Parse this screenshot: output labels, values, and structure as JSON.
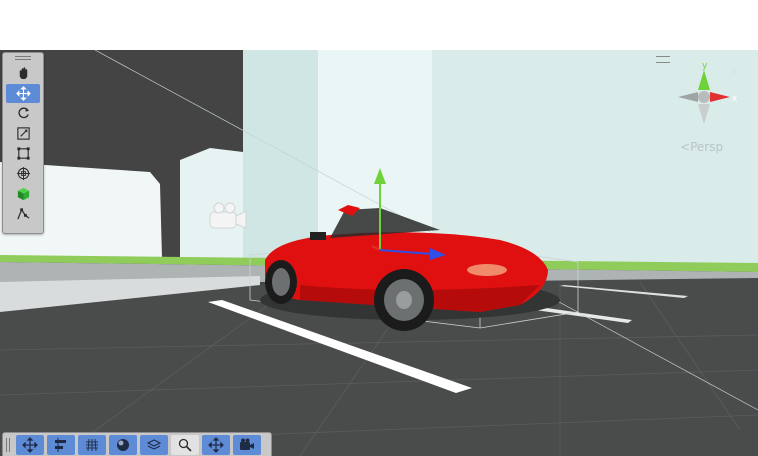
{
  "scene_view": {
    "projection_label": "Persp",
    "axis_labels": {
      "y": "y",
      "x": "x"
    }
  },
  "tools_overlay": {
    "items": [
      {
        "name": "view-tool",
        "icon": "hand-icon",
        "active": false
      },
      {
        "name": "move-tool",
        "icon": "move-arrows-icon",
        "active": true
      },
      {
        "name": "rotate-tool",
        "icon": "rotate-icon",
        "active": false
      },
      {
        "name": "scale-tool",
        "icon": "scale-icon",
        "active": false
      },
      {
        "name": "rect-tool",
        "icon": "rect-transform-icon",
        "active": false
      },
      {
        "name": "transform-tool",
        "icon": "transform-icon",
        "active": false
      },
      {
        "name": "custom-cube-tool",
        "icon": "green-cube-icon",
        "active": false
      },
      {
        "name": "custom-path-tool",
        "icon": "path-icon",
        "active": false
      }
    ]
  },
  "view_options_bar": {
    "items": [
      {
        "name": "move-toggle",
        "icon": "move-arrows-icon",
        "state": "active"
      },
      {
        "name": "align-toggle",
        "icon": "align-icon",
        "state": "active"
      },
      {
        "name": "grid-toggle",
        "icon": "grid-icon",
        "state": "active"
      },
      {
        "name": "shading-toggle",
        "icon": "sphere-icon",
        "state": "active"
      },
      {
        "name": "layers-toggle",
        "icon": "layers-icon",
        "state": "active"
      },
      {
        "name": "search-toggle",
        "icon": "magnifier-icon",
        "state": "highlight"
      },
      {
        "name": "pivot-toggle",
        "icon": "move-arrows-icon",
        "state": "active"
      },
      {
        "name": "camera-toggle",
        "icon": "camera-icon",
        "state": "active"
      }
    ]
  },
  "colors": {
    "accent": "#5e8bd6",
    "toolbar": "#c8c8c8",
    "ground": "#4a4c4c",
    "sky": "#444444",
    "car_body": "#e01010",
    "gizmo_y": "#6fd23a",
    "gizmo_x": "#e03030",
    "gizmo_z": "#2f4fe8"
  }
}
